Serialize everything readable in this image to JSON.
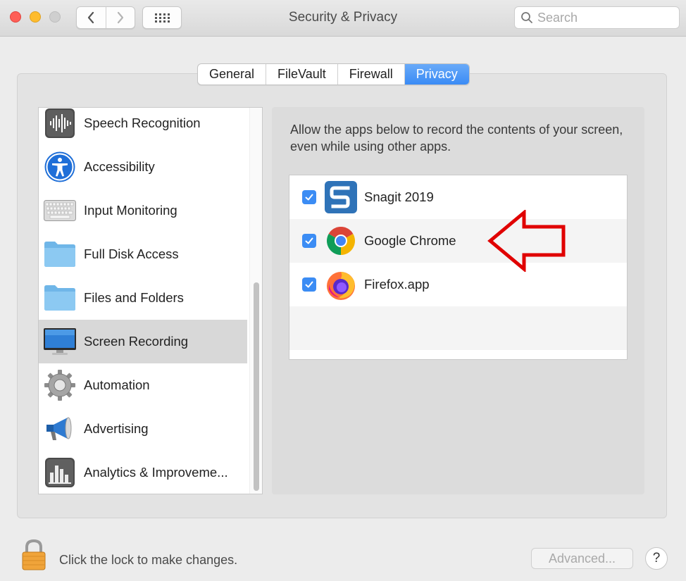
{
  "window": {
    "title": "Security & Privacy",
    "search": {
      "placeholder": "Search"
    }
  },
  "tabs": [
    {
      "label": "General",
      "active": false
    },
    {
      "label": "FileVault",
      "active": false
    },
    {
      "label": "Firewall",
      "active": false
    },
    {
      "label": "Privacy",
      "active": true
    }
  ],
  "sidebar": {
    "items": [
      {
        "label": "Speech Recognition",
        "icon": "waveform-icon",
        "selected": false
      },
      {
        "label": "Accessibility",
        "icon": "accessibility-icon",
        "selected": false
      },
      {
        "label": "Input Monitoring",
        "icon": "keyboard-icon",
        "selected": false
      },
      {
        "label": "Full Disk Access",
        "icon": "folder-icon",
        "selected": false
      },
      {
        "label": "Files and Folders",
        "icon": "folder-icon",
        "selected": false
      },
      {
        "label": "Screen Recording",
        "icon": "display-icon",
        "selected": true
      },
      {
        "label": "Automation",
        "icon": "gear-icon",
        "selected": false
      },
      {
        "label": "Advertising",
        "icon": "megaphone-icon",
        "selected": false
      },
      {
        "label": "Analytics & Improveme...",
        "icon": "bar-chart-icon",
        "selected": false
      }
    ]
  },
  "panel": {
    "description": "Allow the apps below to record the contents of your screen, even while using other apps.",
    "apps": [
      {
        "label": "Snagit 2019",
        "checked": true,
        "icon": "snagit-icon"
      },
      {
        "label": "Google Chrome",
        "checked": true,
        "icon": "chrome-icon"
      },
      {
        "label": "Firefox.app",
        "checked": true,
        "icon": "firefox-icon"
      }
    ]
  },
  "footer": {
    "lock_text": "Click the lock to make changes.",
    "advanced_label": "Advanced...",
    "help_label": "?"
  },
  "colors": {
    "accent": "#3b8cf4",
    "annotation_arrow": "#e00000",
    "selected_row": "#d8d8d8"
  }
}
